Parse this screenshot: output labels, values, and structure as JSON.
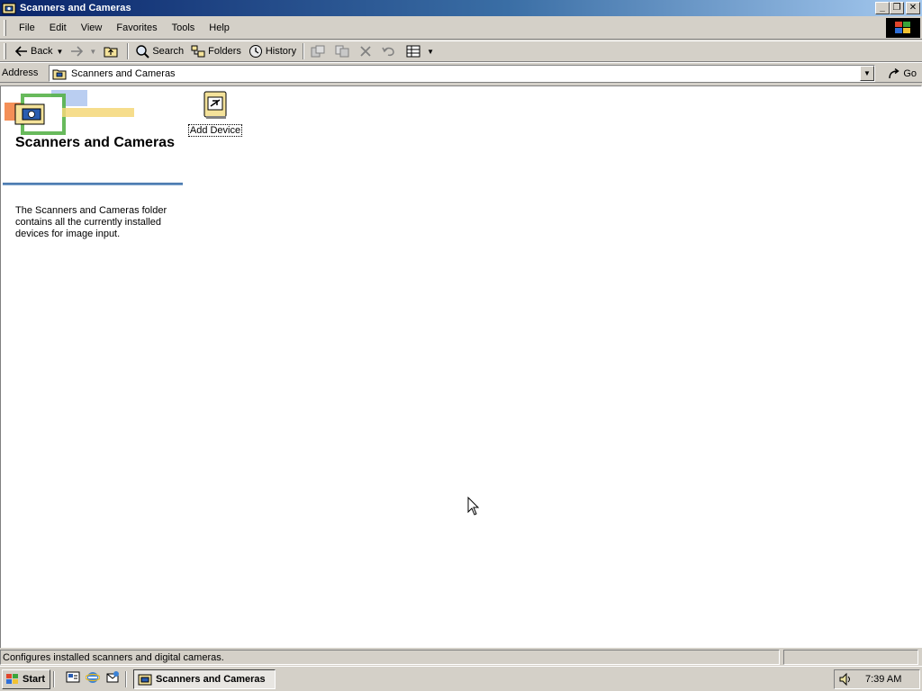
{
  "window": {
    "title": "Scanners and Cameras",
    "controls": {
      "minimize": "_",
      "maximize": "❐",
      "close": "✕"
    }
  },
  "menubar": {
    "items": [
      "File",
      "Edit",
      "View",
      "Favorites",
      "Tools",
      "Help"
    ]
  },
  "toolbar": {
    "back_label": "Back",
    "search_label": "Search",
    "folders_label": "Folders",
    "history_label": "History"
  },
  "address": {
    "label": "Address",
    "value": "Scanners and Cameras",
    "go_label": "Go"
  },
  "folder": {
    "title": "Scanners and Cameras",
    "description": "The Scanners and Cameras folder contains all the currently installed devices for image input."
  },
  "items": [
    {
      "label": "Add Device",
      "icon": "add-device-icon"
    }
  ],
  "statusbar": {
    "text": "Configures installed scanners and digital cameras."
  },
  "taskbar": {
    "start_label": "Start",
    "task_label": "Scanners and Cameras",
    "clock": "7:39 AM"
  },
  "colors": {
    "titlebar_start": "#0a246a",
    "titlebar_end": "#a6caf0",
    "face": "#d4d0c8",
    "accent_rule": "#3a6ea5"
  }
}
